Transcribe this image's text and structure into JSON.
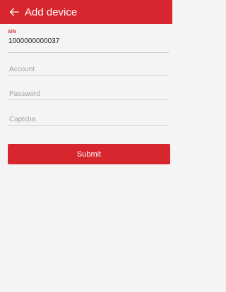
{
  "appbar": {
    "title": "Add device",
    "back_icon": "arrow-left-icon",
    "color": "#d8262e"
  },
  "form": {
    "sn": {
      "label": "S/N",
      "value": "1000000000037"
    },
    "account": {
      "placeholder": "Account",
      "value": ""
    },
    "password": {
      "placeholder": "Password",
      "value": ""
    },
    "captcha": {
      "placeholder": "Captcha",
      "value": ""
    }
  },
  "submit_label": "Submit"
}
